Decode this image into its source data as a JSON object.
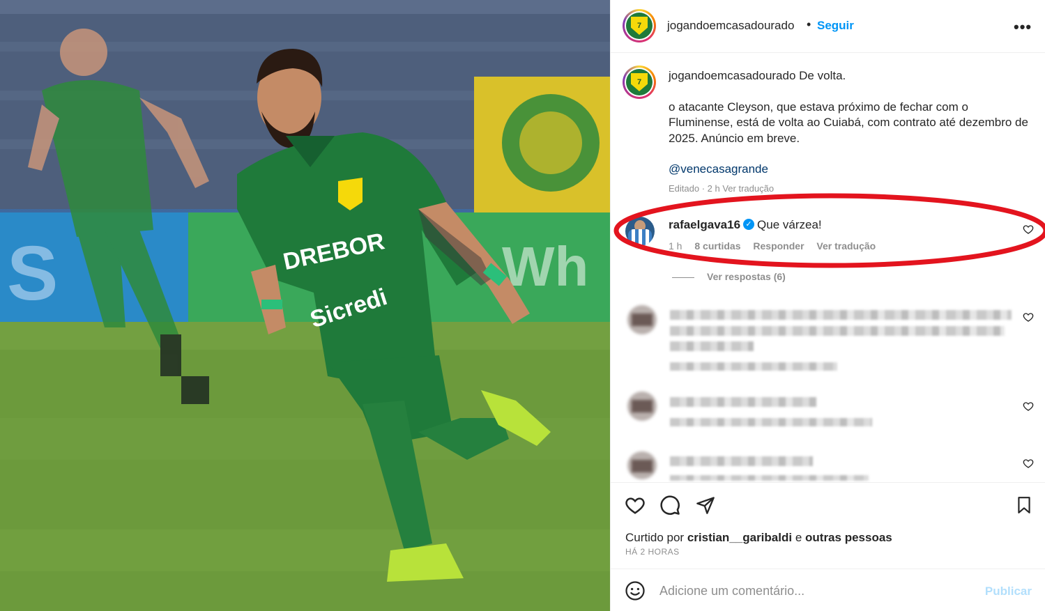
{
  "header": {
    "username": "jogandoemcasadourado",
    "separator": "•",
    "follow_label": "Seguir",
    "more_label": "•••"
  },
  "caption": {
    "username": "jogandoemcasadourado",
    "first_line": "De volta.",
    "body": "o atacante Cleyson, que estava próximo de fechar com o Fluminense, está de volta ao Cuiabá, com contrato até dezembro de 2025. Anúncio em breve.",
    "mention": "@venecasagrande",
    "meta": "Editado · 2 h   Ver tradução"
  },
  "highlighted_comment": {
    "username": "rafaelgava16",
    "verified_mark": "✓",
    "text": "Que várzea!",
    "time": "1 h",
    "likes": "8 curtidas",
    "reply_label": "Responder",
    "translate_label": "Ver tradução",
    "view_replies": "Ver respostas (6)"
  },
  "liked_by": {
    "prefix": "Curtido por",
    "user": "cristian__garibaldi",
    "conjunction": "e",
    "others": "outras pessoas"
  },
  "timestamp": "HÁ 2 HORAS",
  "add_comment": {
    "emoji_icon": "smiley-icon",
    "placeholder": "Adicione um comentário...",
    "publish_label": "Publicar"
  },
  "photo": {
    "jersey_texts": [
      "DREBOR",
      "Sicredi"
    ]
  },
  "colors": {
    "link_blue": "#0095f6",
    "highlight_red": "#e3141e",
    "jersey_green": "#1f7a3a"
  }
}
